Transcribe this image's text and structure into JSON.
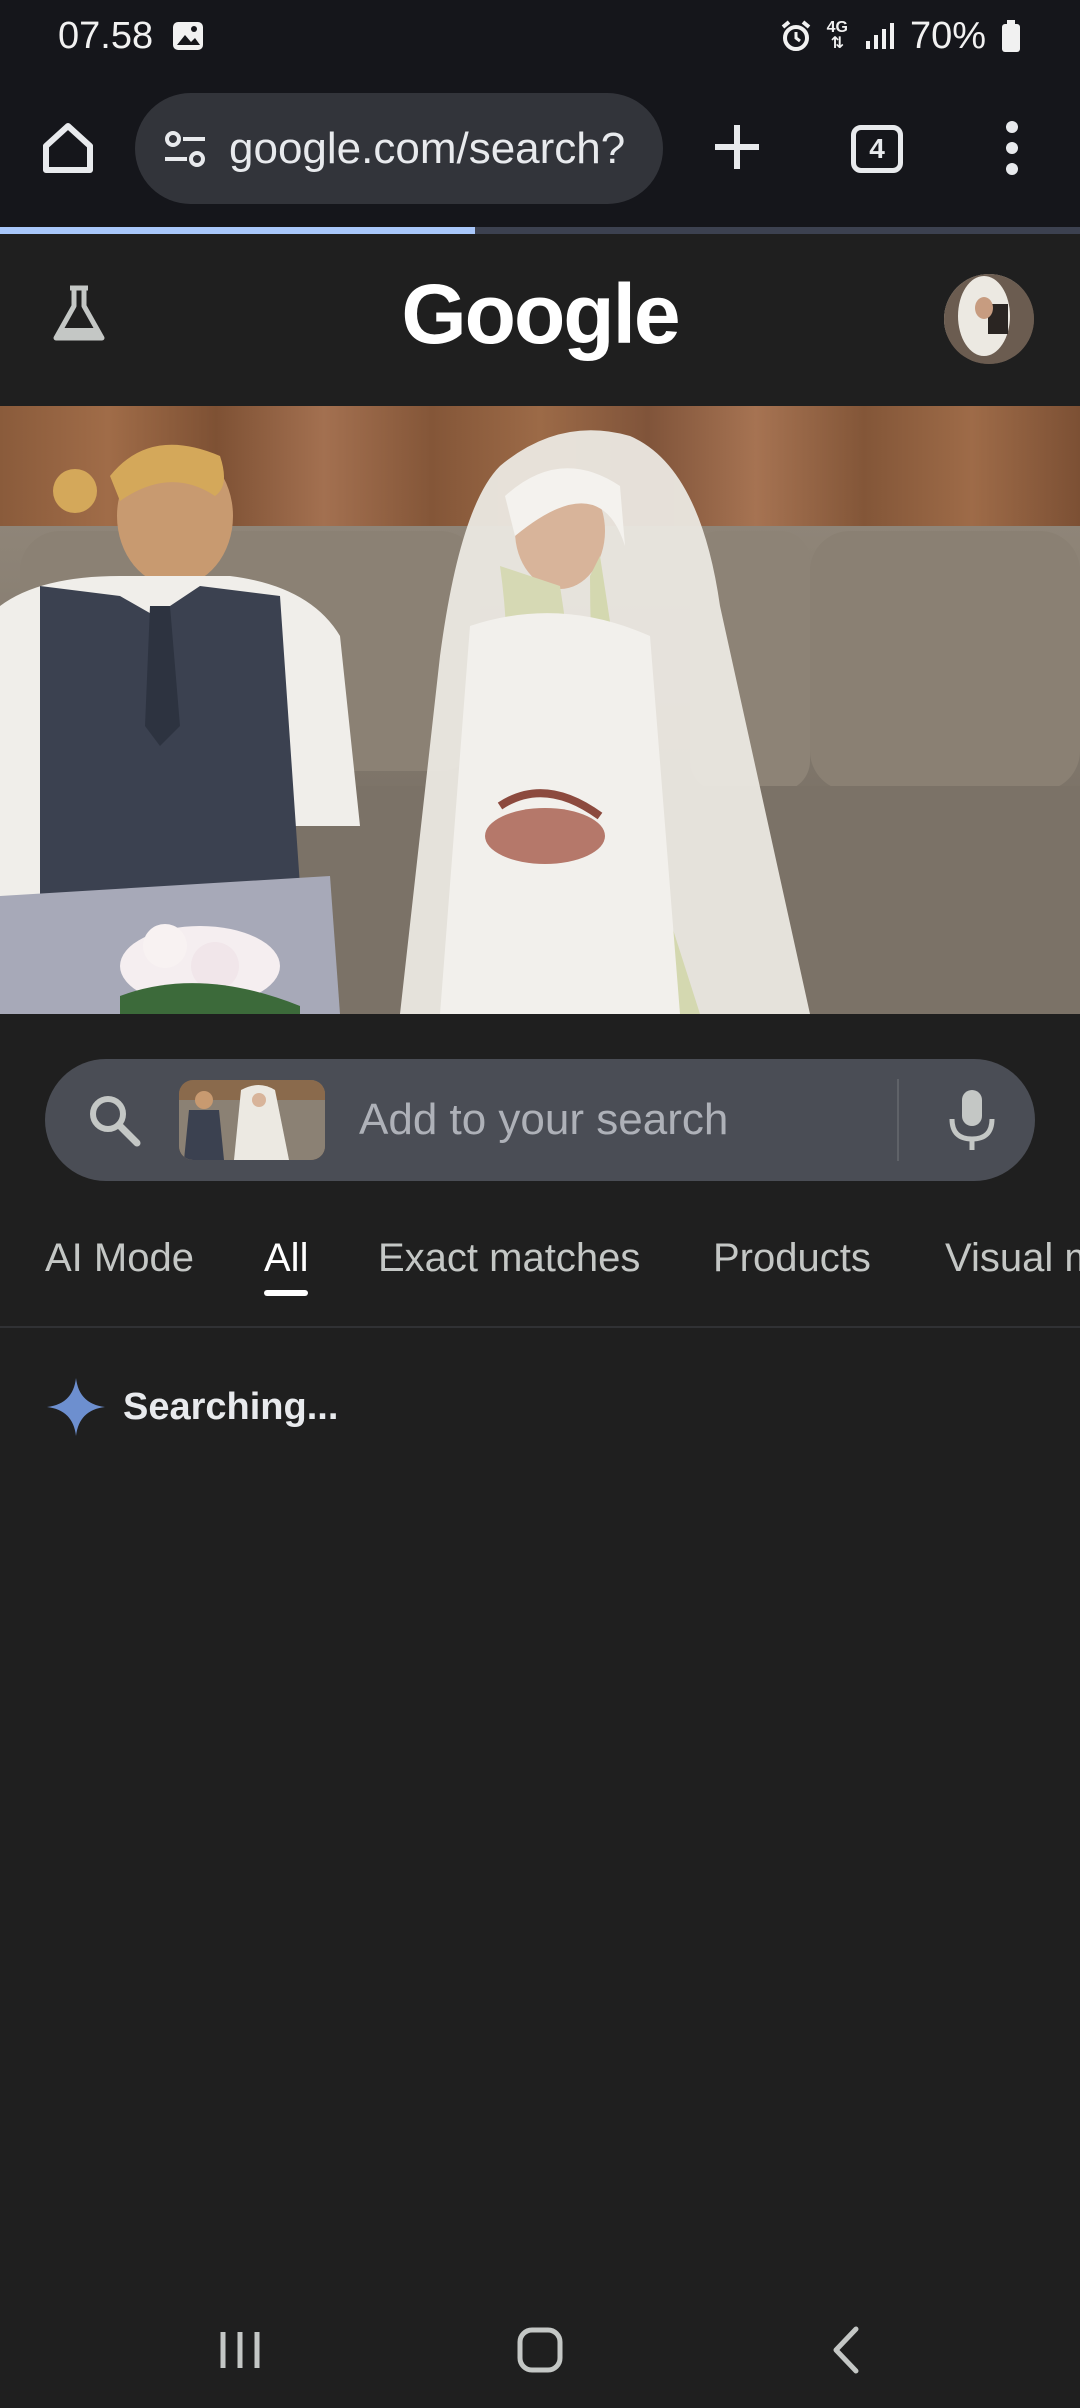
{
  "status_bar": {
    "time": "07.58",
    "network": "4G",
    "battery": "70%",
    "icons": [
      "gallery-icon",
      "alarm-icon",
      "data-arrows-icon",
      "signal-icon",
      "battery-icon"
    ]
  },
  "browser": {
    "url": "google.com/search?",
    "tab_count": "4",
    "page_load_progress": 0.44,
    "icons": [
      "home-icon",
      "site-settings-icon",
      "new-tab-icon",
      "tab-switcher-icon",
      "more-menu-icon"
    ]
  },
  "google_header": {
    "logo": "Google",
    "icons": [
      "labs-flask-icon",
      "account-avatar"
    ]
  },
  "search": {
    "placeholder": "Add to your search",
    "icons": [
      "search-icon",
      "image-thumbnail",
      "microphone-icon"
    ]
  },
  "tabs": [
    {
      "label": "AI Mode",
      "active": false
    },
    {
      "label": "All",
      "active": true
    },
    {
      "label": "Exact matches",
      "active": false
    },
    {
      "label": "Products",
      "active": false
    },
    {
      "label": "Visual m",
      "active": false
    }
  ],
  "status": {
    "text": "Searching..."
  },
  "navigation": {
    "icons": [
      "recent-apps-icon",
      "home-button-icon",
      "back-icon"
    ]
  },
  "colors": {
    "background": "#1f1f1f",
    "chrome_bar": "#15161b",
    "search_pill": "#4a4d55",
    "progress": "#a8c7fa",
    "spark": "#6d8fcf"
  }
}
